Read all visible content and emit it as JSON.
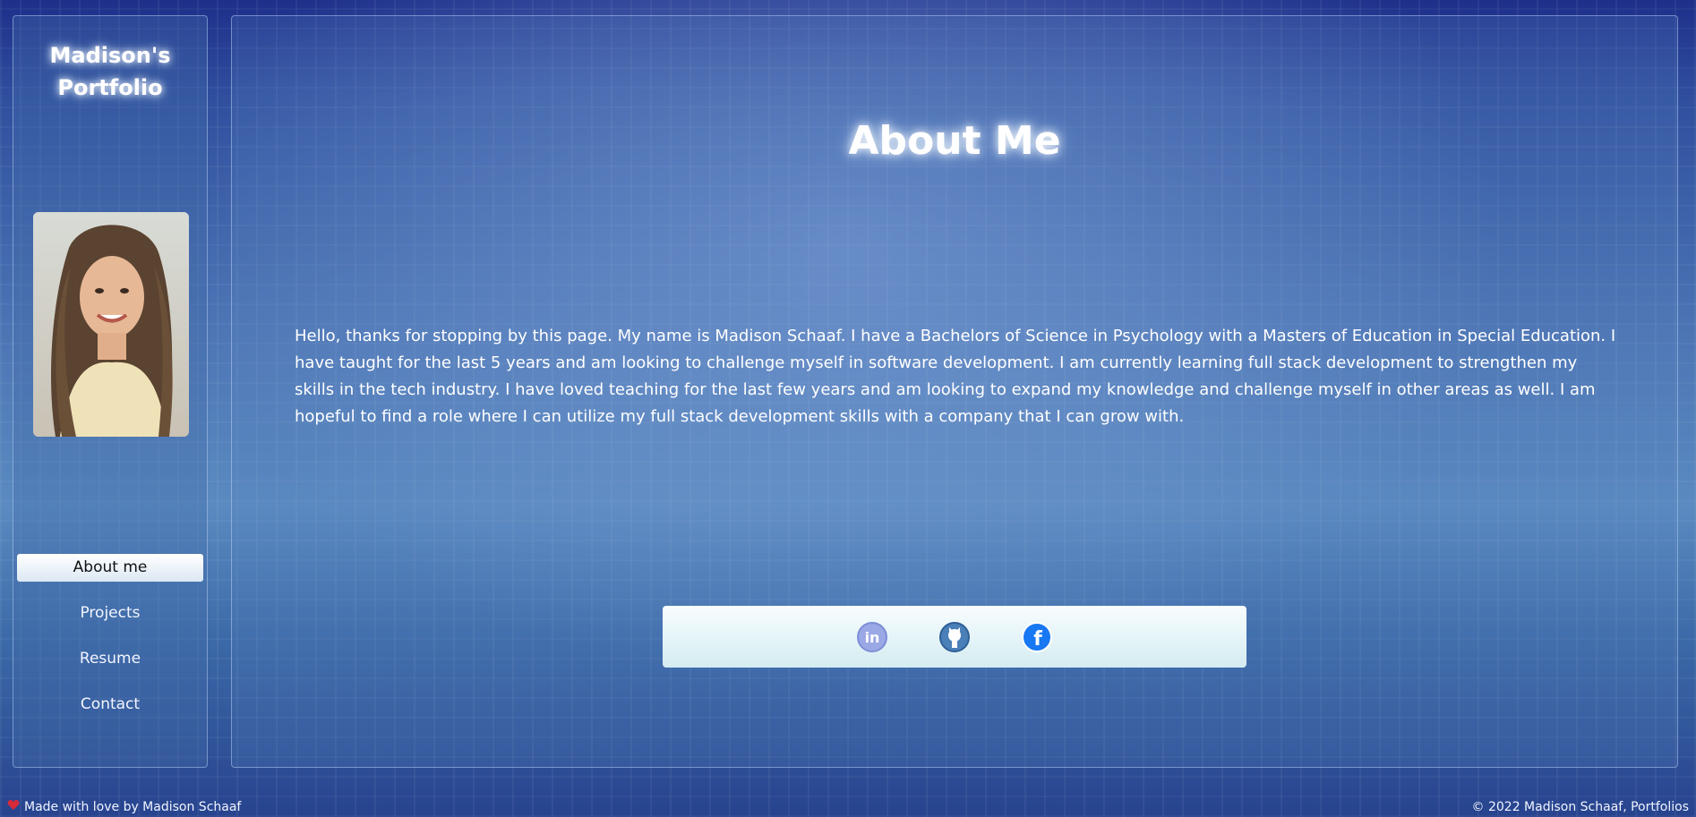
{
  "sidebar": {
    "brand": "Madison's Portfolio",
    "nav": [
      {
        "label": "About me",
        "active": true
      },
      {
        "label": "Projects",
        "active": false
      },
      {
        "label": "Resume",
        "active": false
      },
      {
        "label": "Contact",
        "active": false
      }
    ]
  },
  "main": {
    "title": "About Me",
    "bio": "Hello, thanks for stopping by this page. My name is Madison Schaaf. I have a Bachelors of Science in Psychology with a Masters of Education in Special Education. I have taught for the last 5 years and am looking to challenge myself in software development. I am currently learning full stack development to strengthen my skills in the tech industry. I have loved teaching for the last few years and am looking to expand my knowledge and challenge myself in other areas as well. I am hopeful to find a role where I can utilize my full stack development skills with a company that I can grow with.",
    "social": [
      {
        "icon": "linkedin-icon",
        "color": "#8f9fe0"
      },
      {
        "icon": "github-icon",
        "color": "#4a7fb8"
      },
      {
        "icon": "facebook-icon",
        "color": "#1877f2"
      }
    ]
  },
  "footer": {
    "left_icon": "heart-icon",
    "left": "Made with love by Madison Schaaf",
    "right": "© 2022 Madison Schaaf, Portfolios"
  }
}
